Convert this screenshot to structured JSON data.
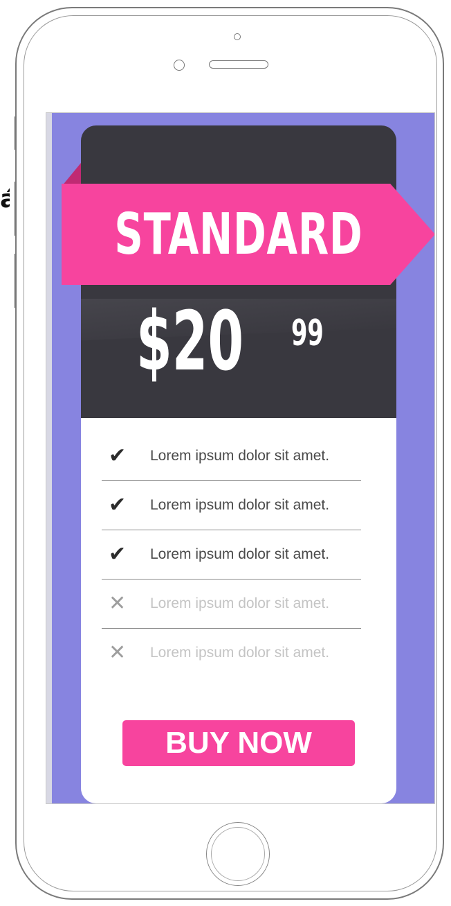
{
  "plan": {
    "name": "STANDARD",
    "price_main": "$20",
    "price_cents": "99"
  },
  "features": [
    {
      "text": "Lorem ipsum dolor sit amet.",
      "included": true,
      "icon": "check-icon"
    },
    {
      "text": "Lorem ipsum dolor sit amet.",
      "included": true,
      "icon": "check-icon"
    },
    {
      "text": "Lorem ipsum dolor sit amet.",
      "included": true,
      "icon": "check-icon"
    },
    {
      "text": "Lorem ipsum dolor sit amet.",
      "included": false,
      "icon": "cross-icon"
    },
    {
      "text": "Lorem ipsum dolor sit amet.",
      "included": false,
      "icon": "cross-icon"
    }
  ],
  "cta": {
    "label": "BUY NOW"
  },
  "stray_text": "á",
  "colors": {
    "background": "#8784e0",
    "card_dark": "#39383f",
    "accent_pink": "#f7449e",
    "ribbon_fold": "#c02a73"
  }
}
